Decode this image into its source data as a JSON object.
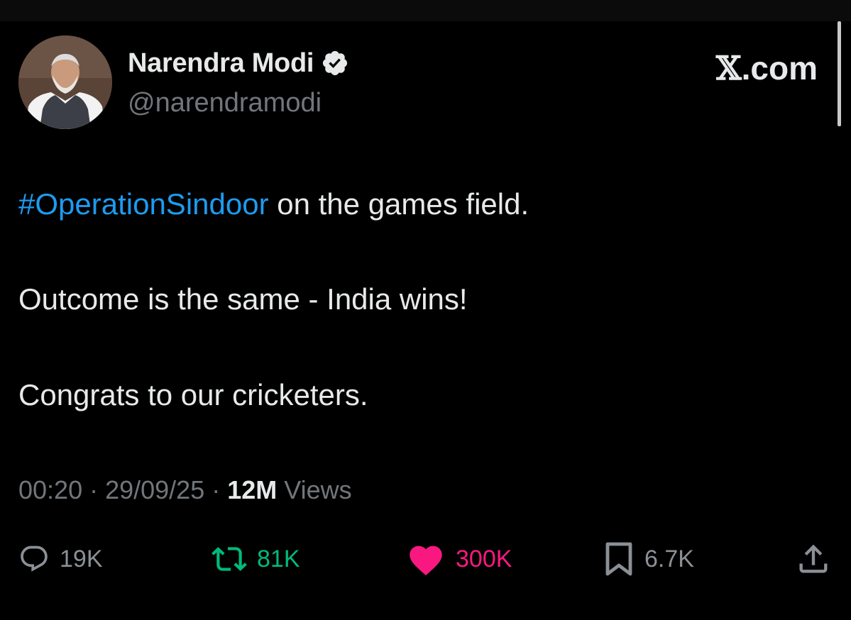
{
  "author": {
    "name": "Narendra Modi",
    "handle": "@narendramodi",
    "verified": true,
    "avatar_icon": "profile-photo-icon"
  },
  "site": {
    "x_mark": "𝕏",
    "domain": ".com"
  },
  "tweet": {
    "hashtag": "#OperationSindoor",
    "line1_rest": " on the games field.",
    "line2": "Outcome is the same - India wins!",
    "line3": "Congrats to our cricketers."
  },
  "meta": {
    "time": "00:20",
    "date": "29/09/25",
    "separator": " · ",
    "views_count": "12M",
    "views_label": " Views"
  },
  "actions": {
    "replies": "19K",
    "retweets": "81K",
    "likes": "300K",
    "bookmarks": "6.7K"
  },
  "colors": {
    "background": "#000000",
    "text": "#e7e9ea",
    "secondary": "#71767b",
    "link": "#1d9bf0",
    "retweet": "#00ba7c",
    "like": "#f91880"
  }
}
